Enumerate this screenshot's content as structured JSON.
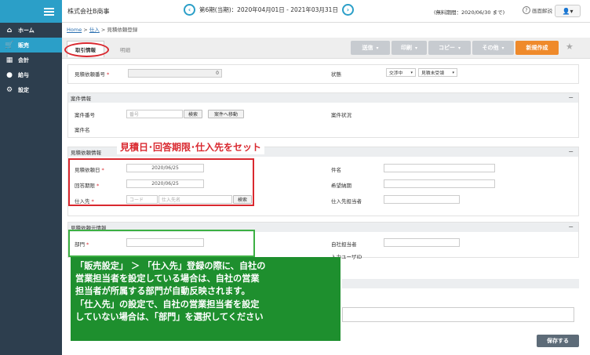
{
  "sidebar": {
    "items": [
      {
        "label": "ホーム",
        "icon": "home-icon",
        "glyph": "⌂"
      },
      {
        "label": "販売",
        "icon": "cart-icon",
        "glyph": "🛒"
      },
      {
        "label": "会計",
        "icon": "ledger-icon",
        "glyph": "▦"
      },
      {
        "label": "給与",
        "icon": "moneybag-icon",
        "glyph": "●"
      },
      {
        "label": "設定",
        "icon": "gear-icon",
        "glyph": "⚙"
      }
    ]
  },
  "header": {
    "company": "株式会社B商事",
    "period": "第6期(当期)：2020年04月01日 - 2021年03月31日",
    "prev": "‹",
    "next": "›",
    "trial": "(無料期間：2020/06/30 まで)",
    "help": "画面解説",
    "help_glyph": "?",
    "user_glyph": "👤▾"
  },
  "breadcrumb": {
    "home": "Home",
    "sep": ">",
    "purchase": "仕入",
    "current": "見積依頼登録"
  },
  "tabs": {
    "active": "取引情報",
    "inactive": "明細"
  },
  "actions": {
    "send": "送信",
    "print": "印刷",
    "copy": "コピー",
    "other": "その他",
    "dd": "▾",
    "new": "新規作成",
    "star": "★"
  },
  "form": {
    "est_no_label": "見積依頼番号",
    "est_no_value": "0",
    "req": "*",
    "status_label": "状態",
    "status1": "交渉中",
    "status2": "見積未受領",
    "case_section": "案件情報",
    "case_no_label": "案件番号",
    "case_no_placeholder": "番号",
    "search": "検索",
    "case_move": "案件へ移動",
    "case_status_label": "案件状況",
    "case_name_label": "案件名",
    "est_section": "見積依頼情報",
    "est_date_label": "見積依頼日",
    "est_date": "2020/06/25",
    "deadline_label": "回答期限",
    "deadline": "2020/06/25",
    "supplier_label": "仕入先",
    "code_ph": "コード",
    "supplier_ph": "仕入先名",
    "subject_label": "件名",
    "desired_label": "希望納期",
    "supplier_contact_label": "仕入先担当者",
    "src_section": "見積依頼元情報",
    "dept_label": "部門",
    "own_contact_label": "自社担当者",
    "user_id_label": "入力ユーザID",
    "collapse": "−",
    "save": "保存する"
  },
  "annotations": {
    "red_caption": "見積日･回答期限･仕入先をセット",
    "green_lines": [
      "「販売設定」 ＞ 「仕入先」登録の際に、自社の",
      "営業担当者を設定している場合は、自社の営業",
      "担当者が所属する部門が自動反映されます。",
      "「仕入先」の設定で、自社の営業担当者を設定",
      "していない場合は、「部門」を選択してください"
    ]
  }
}
